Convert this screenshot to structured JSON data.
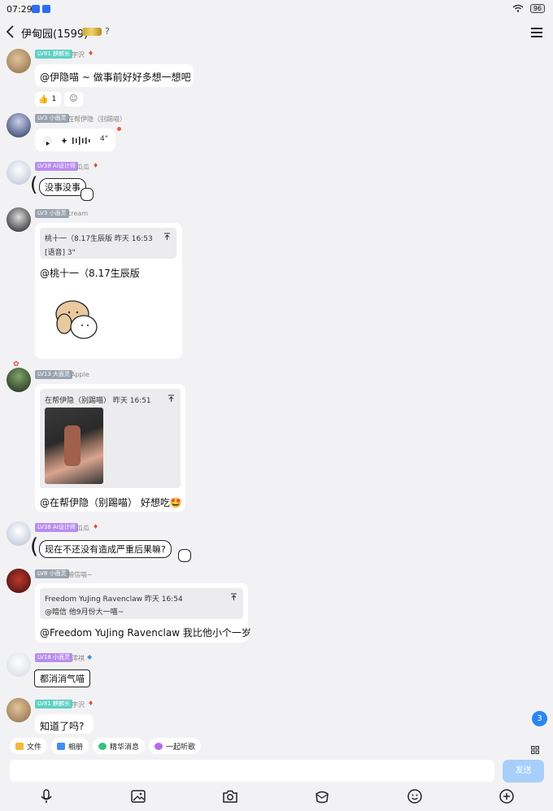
{
  "status_bar": {
    "time": "07:29",
    "battery": "96"
  },
  "header": {
    "title": "伊甸园(1599)"
  },
  "messages": [
    {
      "level": "LV81 麒麟长",
      "name": "宇沢",
      "text": "@伊隐喵 ~ 做事前好好多想一想吧",
      "reaction_count": "1"
    },
    {
      "level": "LV3 小面灵",
      "name": "在帮伊隐（别踢喵）",
      "voice_duration": "4\""
    },
    {
      "level": "LV38 AI设计师",
      "name": "瓜瓜",
      "sticker_text": "没事没事"
    },
    {
      "level": "LV3 小面灵",
      "name": "cream",
      "quote_header": "桃十一（8.17生辰版 昨天 16:53",
      "quote_body": "[语音] 3\"",
      "text": "@桃十一（8.17生辰版"
    },
    {
      "level": "LV13 大面灵",
      "name": "Apple",
      "quote_header": "在帮伊隐（别踢喵） 昨天 16:51",
      "text": "@在帮伊隐（别踢喵） 好想吃🤩"
    },
    {
      "level": "LV38 AI设计师",
      "name": "瓜瓜",
      "sticker_text": "现在不还没有造成严重后果嘛?"
    },
    {
      "level": "LV8 小面灵",
      "name": "暗信喵~",
      "quote_header": "Freedom YuJing Ravenclaw 昨天 16:54",
      "quote_body": "@暗信 他9月份大一喵~",
      "text": "@Freedom YuJing Ravenclaw 我比他小个一岁"
    },
    {
      "level": "LV18 小面灵",
      "name": "澪祺",
      "sticker_text": "都消消气喵"
    },
    {
      "level": "LV81 麒麟长",
      "name": "宇沢",
      "text": "知道了吗?"
    }
  ],
  "unread_count": "3",
  "toolbar": {
    "chips": [
      "文件",
      "相册",
      "精华消息",
      "一起听歌"
    ]
  },
  "input": {
    "placeholder": "",
    "send_label": "发送"
  },
  "colors": {
    "accent": "#2b86f0",
    "send_disabled": "#a7cffa",
    "level_teal": "#5fd0c4",
    "level_purple": "#b88cf0",
    "level_gray": "#9aa3ad"
  }
}
